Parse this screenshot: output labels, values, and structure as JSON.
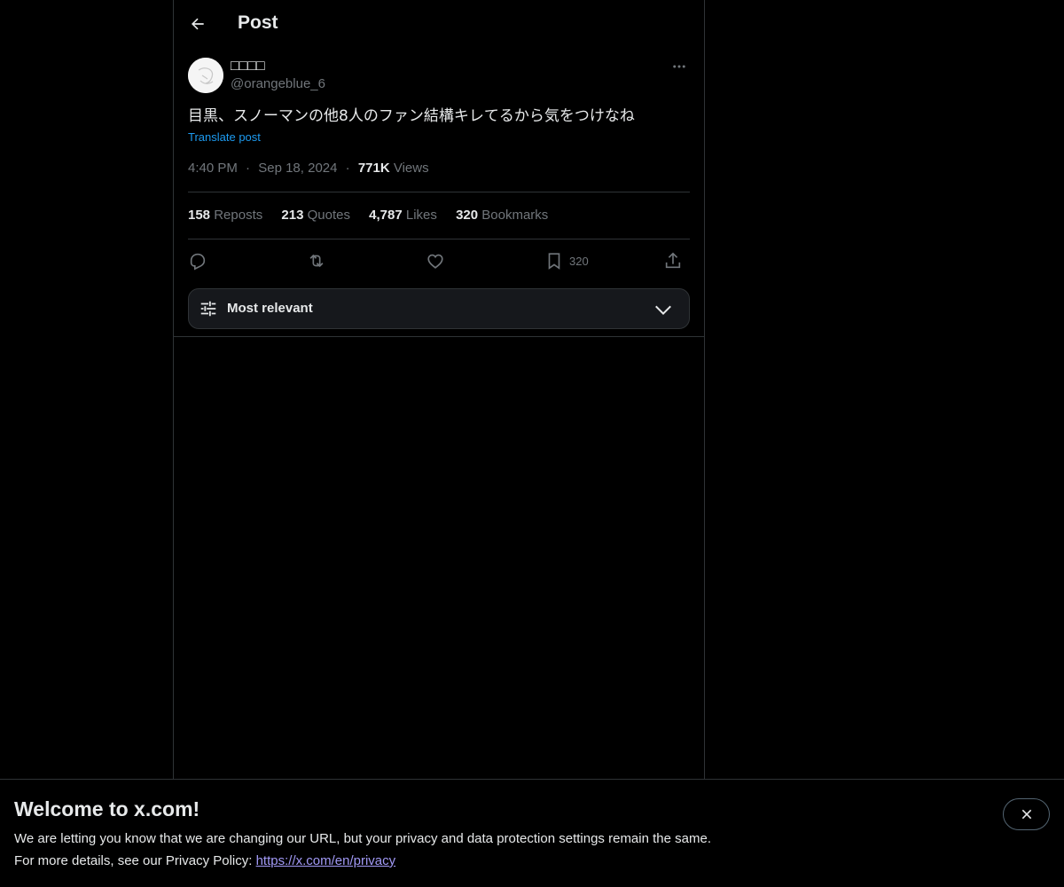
{
  "header": {
    "title": "Post",
    "back_icon": "arrow-left-icon"
  },
  "post": {
    "author": {
      "display_name": "□□□□",
      "handle": "@orangeblue_6"
    },
    "text": "目黒、スノーマンの他8人のファン結構キレてるから気をつけなね",
    "translate_label": "Translate post",
    "time": "4:40 PM",
    "date": "Sep 18, 2024",
    "views_count": "771K",
    "views_label": "Views",
    "stats": {
      "reposts_count": "158",
      "reposts_label": "Reposts",
      "quotes_count": "213",
      "quotes_label": "Quotes",
      "likes_count": "4,787",
      "likes_label": "Likes",
      "bookmarks_count": "320",
      "bookmarks_label": "Bookmarks"
    },
    "actions": {
      "reply_icon": "reply-icon",
      "repost_icon": "repost-icon",
      "like_icon": "heart-icon",
      "bookmark_icon": "bookmark-icon",
      "bookmark_count": "320",
      "share_icon": "share-icon"
    }
  },
  "replies_sort": {
    "label": "Most relevant",
    "icon": "sliders-icon"
  },
  "banner": {
    "title": "Welcome to x.com!",
    "line1": "We are letting you know that we are changing our URL, but your privacy and data protection settings remain the same.",
    "line2_prefix": "For more details, see our Privacy Policy: ",
    "privacy_link": "https://x.com/en/privacy"
  },
  "colors": {
    "background": "#000000",
    "text_primary": "#e7e9ea",
    "text_secondary": "#71767b",
    "link": "#1d9bf0",
    "border": "#2f3336",
    "privacy_link": "#a199f5"
  }
}
